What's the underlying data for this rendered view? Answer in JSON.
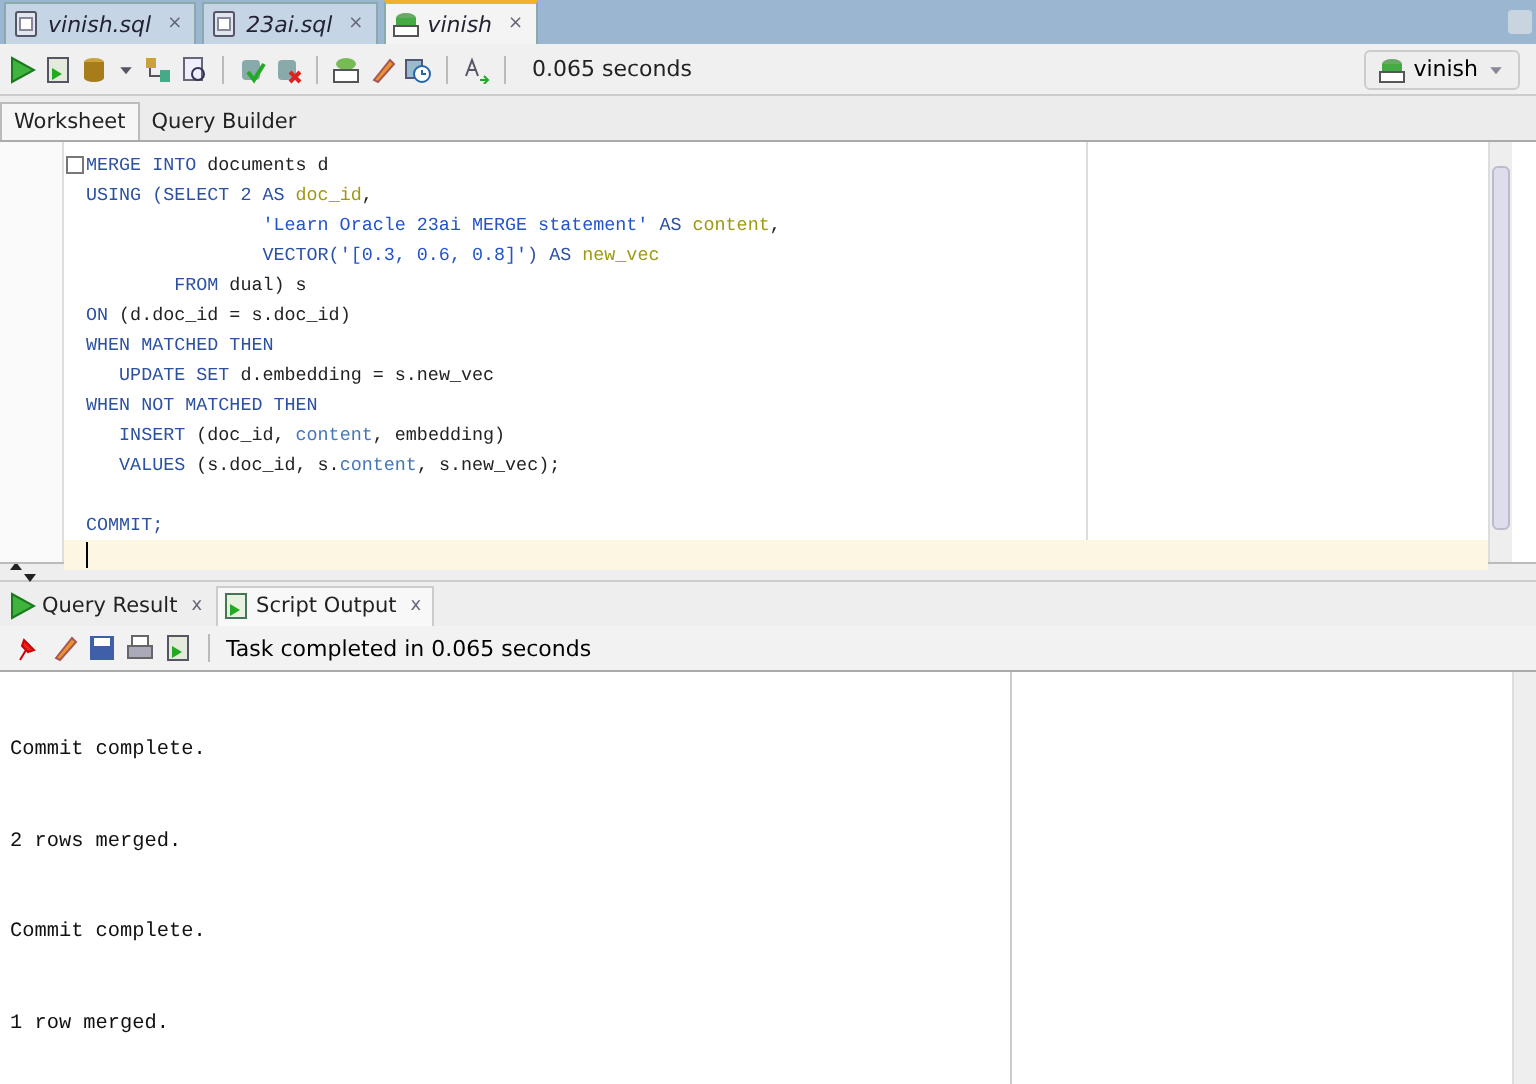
{
  "file_tabs": [
    {
      "label": "vinish.sql",
      "close": "×",
      "selected": false
    },
    {
      "label": "23ai.sql",
      "close": "×",
      "selected": false
    },
    {
      "label": "vinish",
      "close": "×",
      "selected": true
    }
  ],
  "toolbar": {
    "timing": "0.065 seconds",
    "connection": "vinish"
  },
  "editor_tabs": [
    {
      "label": "Worksheet",
      "selected": true
    },
    {
      "label": "Query Builder",
      "selected": false
    }
  ],
  "code_lines": [
    {
      "tokens": [
        {
          "text": "MERGE INTO",
          "kind": "kw"
        },
        {
          "text": " documents d",
          "kind": "plain"
        }
      ],
      "foldable": true,
      "current": false
    },
    {
      "tokens": [
        {
          "text": "USING (SELECT ",
          "kind": "kw"
        },
        {
          "text": "2",
          "kind": "num"
        },
        {
          "text": " AS ",
          "kind": "kw"
        },
        {
          "text": "doc_id",
          "kind": "alias"
        },
        {
          "text": ",",
          "kind": "plain"
        }
      ],
      "foldable": false,
      "current": false
    },
    {
      "tokens": [
        {
          "text": "                'Learn Oracle 23ai MERGE statement'",
          "kind": "str"
        },
        {
          "text": " AS ",
          "kind": "kw"
        },
        {
          "text": "content",
          "kind": "alias"
        },
        {
          "text": ",",
          "kind": "plain"
        }
      ],
      "foldable": false,
      "current": false
    },
    {
      "tokens": [
        {
          "text": "                VECTOR(",
          "kind": "kw"
        },
        {
          "text": "'[0.3, 0.6, 0.8]'",
          "kind": "str"
        },
        {
          "text": ") AS ",
          "kind": "kw"
        },
        {
          "text": "new_vec",
          "kind": "alias"
        }
      ],
      "foldable": false,
      "current": false
    },
    {
      "tokens": [
        {
          "text": "        FROM",
          "kind": "kw"
        },
        {
          "text": " dual) s",
          "kind": "plain"
        }
      ],
      "foldable": false,
      "current": false
    },
    {
      "tokens": [
        {
          "text": "ON",
          "kind": "kw"
        },
        {
          "text": " (d.doc_id = s.doc_id)",
          "kind": "plain"
        }
      ],
      "foldable": false,
      "current": false
    },
    {
      "tokens": [
        {
          "text": "WHEN MATCHED THEN",
          "kind": "kw"
        }
      ],
      "foldable": false,
      "current": false
    },
    {
      "tokens": [
        {
          "text": "   UPDATE SET",
          "kind": "kw"
        },
        {
          "text": " d.embedding = s.new_vec",
          "kind": "plain"
        }
      ],
      "foldable": false,
      "current": false
    },
    {
      "tokens": [
        {
          "text": "WHEN NOT MATCHED THEN",
          "kind": "kw"
        }
      ],
      "foldable": false,
      "current": false
    },
    {
      "tokens": [
        {
          "text": "   INSERT",
          "kind": "kw"
        },
        {
          "text": " (doc_id, ",
          "kind": "plain"
        },
        {
          "text": "content",
          "kind": "col"
        },
        {
          "text": ", embedding)",
          "kind": "plain"
        }
      ],
      "foldable": false,
      "current": false
    },
    {
      "tokens": [
        {
          "text": "   VALUES",
          "kind": "kw"
        },
        {
          "text": " (s.doc_id, s.",
          "kind": "plain"
        },
        {
          "text": "content",
          "kind": "col"
        },
        {
          "text": ", s.new_vec);",
          "kind": "plain"
        }
      ],
      "foldable": false,
      "current": false
    },
    {
      "foldable": false,
      "current": false
    },
    {
      "tokens": [
        {
          "text": "COMMIT;",
          "kind": "kw"
        }
      ],
      "foldable": false,
      "current": false
    },
    {
      "foldable": false,
      "current": true
    }
  ],
  "output_tabs": [
    {
      "label": "Query Result",
      "close": "x",
      "selected": false
    },
    {
      "label": "Script Output",
      "close": "x",
      "selected": true
    }
  ],
  "output_status": "Task completed in 0.065 seconds",
  "output_lines": [
    "Commit complete.",
    "2 rows merged.",
    "Commit complete.",
    "1 row merged."
  ]
}
